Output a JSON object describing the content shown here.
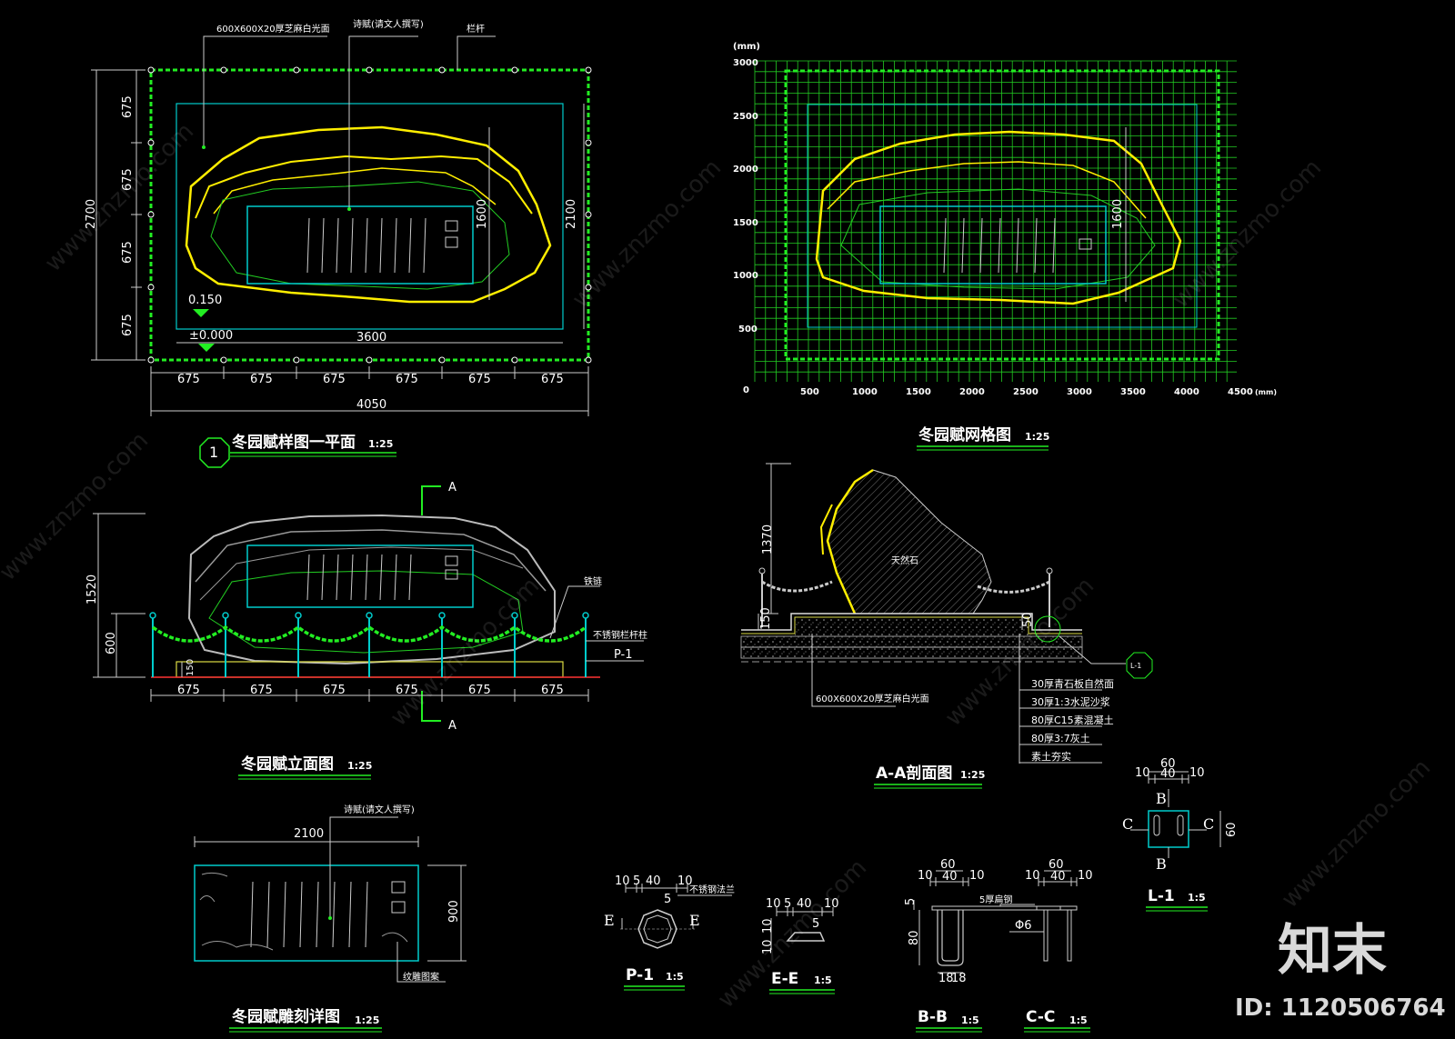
{
  "plan": {
    "note_paving": "600X600X20厚芝麻白光面",
    "note_poem": "诗赋(请文人撰写)",
    "note_rail": "栏杆",
    "dim_total_w": "4050",
    "dim_seg": "675",
    "dim_inner_w": "3600",
    "dim_total_h": "2700",
    "dim_inner_h": "2100",
    "dim_panel_h": "1600",
    "level_top": "0.150",
    "level_base": "±0.000",
    "title_no": "1",
    "title": "冬园赋样图一平面",
    "scale": "1:25"
  },
  "grid": {
    "unit": "(mm)",
    "x_ticks": [
      "0",
      "500",
      "1000",
      "1500",
      "2000",
      "2500",
      "3000",
      "3500",
      "4000",
      "4500"
    ],
    "y_ticks": [
      "3000",
      "2500",
      "2000",
      "1500",
      "1000",
      "500"
    ],
    "x_unit": "(mm)",
    "dim_panel_h": "1600",
    "title": "冬园赋网格图",
    "scale": "1:25"
  },
  "elevation": {
    "section_mark": "A",
    "dim_total_h": "1520",
    "dim_rail_h": "600",
    "dim_base": "150",
    "dim_seg": "675",
    "note_chain": "铁链",
    "note_post": "不锈钢栏杆柱",
    "note_p1": "P-1",
    "title": "冬园赋立面图",
    "scale": "1:25"
  },
  "section": {
    "dim_h": "1370",
    "dim_base_l": "150",
    "dim_base_r": "50",
    "stone_label": "天然石",
    "note_paving": "600X600X20厚芝麻白光面",
    "detail_ref": "L-1",
    "layers": [
      "30厚青石板自然面",
      "30厚1:3水泥沙浆",
      "80厚C15素混凝土",
      "80厚3:7灰土",
      "素土夯实"
    ],
    "title": "A-A剖面图",
    "scale": "1:25"
  },
  "carving": {
    "dim_w": "2100",
    "dim_h": "900",
    "note_poem": "诗赋(请文人撰写)",
    "note_pattern": "纹雕图案",
    "title": "冬园赋雕刻详图",
    "scale": "1:25"
  },
  "p1": {
    "dims": [
      "10",
      "5",
      "40",
      "10"
    ],
    "dim_5": "5",
    "cut": "E",
    "note": "不锈钢法兰",
    "title": "P-1",
    "scale": "1:5"
  },
  "ee": {
    "dims": [
      "10",
      "5",
      "40",
      "10"
    ],
    "dim_v": [
      "10",
      "10"
    ],
    "dim_5": "5",
    "title": "E-E",
    "scale": "1:5"
  },
  "bb": {
    "dim_top": "60",
    "dims": [
      "10",
      "40",
      "10"
    ],
    "dim_5": "5",
    "dim_80": "80",
    "dim_bottom": [
      "18",
      "18"
    ],
    "note": "5厚扁钢",
    "title": "B-B",
    "scale": "1:5"
  },
  "cc": {
    "dim_top": "60",
    "dims": [
      "10",
      "40",
      "10"
    ],
    "note": "Φ6",
    "title": "C-C",
    "scale": "1:5"
  },
  "l1": {
    "dim_top": "60",
    "dims": [
      "10",
      "40",
      "10"
    ],
    "cut_b": "B",
    "cut_c": "C",
    "dim_60": "60",
    "title": "L-1",
    "scale": "1:5"
  },
  "watermark": {
    "text": "www.znzmo.com",
    "brand": "知末",
    "id": "ID: 1120506764"
  }
}
